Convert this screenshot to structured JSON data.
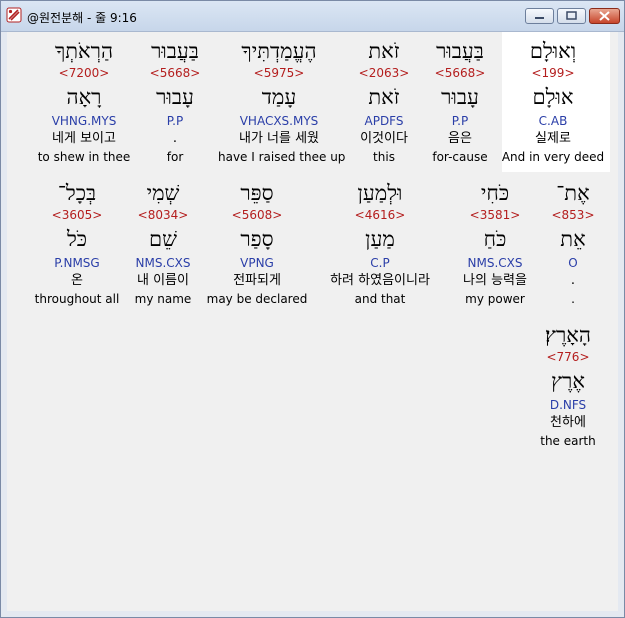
{
  "window": {
    "title": "@원전분해 - 줄 9:16",
    "icon": "app-icon",
    "controls": [
      "minimize-button",
      "maximize-button",
      "close-button"
    ]
  },
  "colors": {
    "strong_number": "#b41e1e",
    "parsing": "#2a3ea8",
    "highlight_bg": "#ffffff"
  },
  "rows": [
    {
      "words": [
        {
          "heb": "וְאוּלָם",
          "strong": "<199>",
          "lemma": "אוּלָם",
          "parse": "C.AB",
          "kor": "실제로",
          "eng": "And in very deed",
          "highlighted": true
        },
        {
          "heb": "בַּעֲבוּר",
          "strong": "<5668>",
          "lemma": "עָבוּר",
          "parse": "P.P",
          "kor": "음은",
          "eng": "for-cause",
          "highlighted": false
        },
        {
          "heb": "זֹאת",
          "strong": "<2063>",
          "lemma": "זֹאת",
          "parse": "APDFS",
          "kor": "이것이다",
          "eng": "this",
          "highlighted": false
        },
        {
          "heb": "הֶעֱמַדְתִּיךָ",
          "strong": "<5975>",
          "lemma": "עָמַד",
          "parse": "VHACXS.MYS",
          "kor": "내가 너를 세웠",
          "eng": "have I raised thee up",
          "highlighted": false
        },
        {
          "heb": "בַּעֲבוּר",
          "strong": "<5668>",
          "lemma": "עָבוּר",
          "parse": "P.P",
          "kor": ".",
          "eng": "for",
          "highlighted": false
        },
        {
          "heb": "הַרְאֹתְךָ",
          "strong": "<7200>",
          "lemma": "רָאָה",
          "parse": "VHNG.MYS",
          "kor": "네게 보이고",
          "eng": "to shew in thee",
          "highlighted": false
        }
      ]
    },
    {
      "words": [
        {
          "heb": "אֶת־",
          "strong": "<853>",
          "lemma": "אֵת",
          "parse": "O",
          "kor": ".",
          "eng": ".",
          "highlighted": false
        },
        {
          "heb": "כֹּחִי",
          "strong": "<3581>",
          "lemma": "כֹּחַ",
          "parse": "NMS.CXS",
          "kor": "나의 능력을",
          "eng": "my power",
          "highlighted": false
        },
        {
          "heb": "וּלְמַעַן",
          "strong": "<4616>",
          "lemma": "מַעַן",
          "parse": "C.P",
          "kor": "하려 하였음이니라",
          "eng": "and that",
          "highlighted": false
        },
        {
          "heb": "סַפֵּר",
          "strong": "<5608>",
          "lemma": "סָפַר",
          "parse": "VPNG",
          "kor": "전파되게",
          "eng": "may be declared",
          "highlighted": false
        },
        {
          "heb": "שְׁמִי",
          "strong": "<8034>",
          "lemma": "שֵׁם",
          "parse": "NMS.CXS",
          "kor": "내 이름이",
          "eng": "my name",
          "highlighted": false
        },
        {
          "heb": "בְּכָל־",
          "strong": "<3605>",
          "lemma": "כֹּל",
          "parse": "P.NMSG",
          "kor": "온",
          "eng": "throughout all",
          "highlighted": false
        }
      ]
    },
    {
      "words": [
        {
          "heb": "הָאָרֶץ׃",
          "strong": "<776>",
          "lemma": "אֶרֶץ",
          "parse": "D.NFS",
          "kor": "천하에",
          "eng": "the earth",
          "highlighted": false
        }
      ]
    }
  ]
}
